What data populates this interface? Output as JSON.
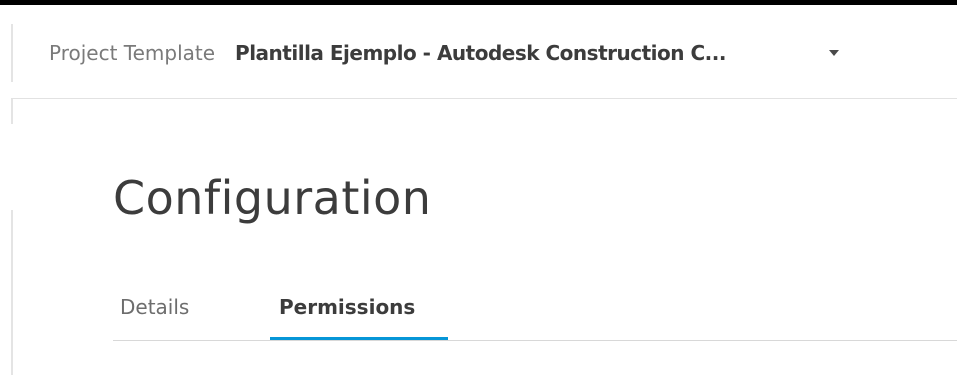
{
  "header": {
    "project_label": "Project Template",
    "project_name": "Plantilla Ejemplo - Autodesk Construction C...",
    "dropdown_icon": "caret-down-icon"
  },
  "page": {
    "title": "Configuration"
  },
  "tabs": [
    {
      "label": "Details",
      "active": false
    },
    {
      "label": "Permissions",
      "active": true
    }
  ],
  "colors": {
    "accent": "#0696d7",
    "text_primary": "#3c3c3c",
    "text_secondary": "#7a7a7a",
    "top_bar": "#000000"
  }
}
